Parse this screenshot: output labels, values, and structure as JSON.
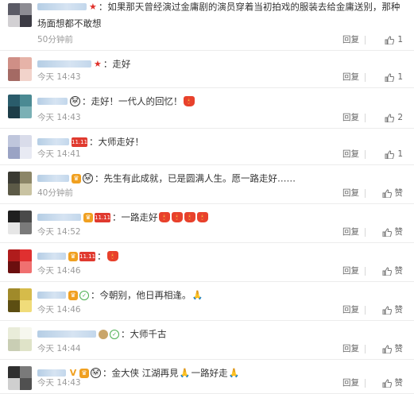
{
  "comments": [
    {
      "name_width": 62,
      "badges": [
        {
          "type": "star",
          "glyph": "★"
        }
      ],
      "text": "如果那天曾经演过金庸剧的演员穿着当初拍戏的服装去给金庸送别，那种场面想都不敢想",
      "emojis": [],
      "time": "50分钟前",
      "reply": "回复",
      "likes": "1",
      "avatar": [
        "#5b5b66",
        "#8d8c93",
        "#d2d0d3",
        "#3c3b44"
      ]
    },
    {
      "name_width": 68,
      "badges": [
        {
          "type": "star",
          "glyph": "★"
        }
      ],
      "text": "走好",
      "emojis": [],
      "time": "今天 14:43",
      "reply": "回复",
      "likes": "1",
      "avatar": [
        "#cf8f86",
        "#e6b3a8",
        "#a46a64",
        "#f2d3cb"
      ]
    },
    {
      "name_width": 38,
      "badges": [
        {
          "type": "panda",
          "glyph": "🐼"
        }
      ],
      "text": "走好！一代人的回忆！",
      "emojis": [
        {
          "type": "candle",
          "glyph": "🕯"
        }
      ],
      "time": "今天 14:43",
      "reply": "回复",
      "likes": "2",
      "avatar": [
        "#2a5c6b",
        "#4b8a93",
        "#1d3d48",
        "#7ab0b5"
      ]
    },
    {
      "name_width": 40,
      "badges": [
        {
          "type": "red",
          "glyph": "11.11"
        }
      ],
      "text": "大师走好！",
      "emojis": [],
      "time": "今天 14:41",
      "reply": "回复",
      "likes": "1",
      "avatar": [
        "#bfc6dc",
        "#d9dcea",
        "#9aa3c4",
        "#e8eaf3"
      ]
    },
    {
      "name_width": 40,
      "badges": [
        {
          "type": "gold",
          "glyph": "♛"
        },
        {
          "type": "panda",
          "glyph": "🐼"
        }
      ],
      "text": "先生有此成就，已是圆满人生。愿一路走好……",
      "emojis": [],
      "time": "40分钟前",
      "reply": "回复",
      "likes": "赞",
      "avatar": [
        "#3a3a32",
        "#8c8667",
        "#5c5a47",
        "#c9c3a2"
      ]
    },
    {
      "name_width": 55,
      "badges": [
        {
          "type": "gold",
          "glyph": "♛"
        },
        {
          "type": "red",
          "glyph": "11.11"
        }
      ],
      "text": "一路走好",
      "emojis": [
        {
          "type": "candle",
          "glyph": "🕯"
        },
        {
          "type": "candle",
          "glyph": "🕯"
        },
        {
          "type": "candle",
          "glyph": "🕯"
        },
        {
          "type": "candle",
          "glyph": "🕯"
        }
      ],
      "time": "今天 14:52",
      "reply": "回复",
      "likes": "赞",
      "avatar": [
        "#1f1f1f",
        "#4a4a4a",
        "#e6e6e6",
        "#7a7a7a"
      ]
    },
    {
      "name_width": 36,
      "badges": [
        {
          "type": "gold",
          "glyph": "♛"
        },
        {
          "type": "red",
          "glyph": "11.11"
        }
      ],
      "text": "",
      "emojis": [
        {
          "type": "candle",
          "glyph": "🕯"
        }
      ],
      "time": "今天 14:46",
      "reply": "回复",
      "likes": "赞",
      "avatar": [
        "#b01c1c",
        "#e03030",
        "#6b0f0f",
        "#f07070"
      ]
    },
    {
      "name_width": 36,
      "badges": [
        {
          "type": "gold",
          "glyph": "♛"
        },
        {
          "type": "green",
          "glyph": "✓"
        }
      ],
      "text": "今朝别，他日再相逢。",
      "emojis": [
        {
          "type": "pray",
          "glyph": "🙏"
        }
      ],
      "time": "今天 14:46",
      "reply": "回复",
      "likes": "赞",
      "avatar": [
        "#a08a2a",
        "#d6bb4a",
        "#5c4e12",
        "#f0dc7a"
      ]
    },
    {
      "name_width": 74,
      "badges": [
        {
          "type": "owl",
          "glyph": ""
        },
        {
          "type": "green",
          "glyph": "✓"
        }
      ],
      "text": "大师千古",
      "emojis": [],
      "time": "今天 14:44",
      "reply": "回复",
      "likes": "赞",
      "avatar": [
        "#e9ecd9",
        "#f6f7ee",
        "#c9ceb4",
        "#dfe3c8"
      ]
    },
    {
      "name_width": 36,
      "badges": [
        {
          "type": "vip",
          "glyph": "V"
        },
        {
          "type": "gold",
          "glyph": "♛"
        },
        {
          "type": "panda",
          "glyph": "🐼"
        }
      ],
      "text": "金大侠 江湖再見",
      "emojis": [
        {
          "type": "pray",
          "glyph": "🙏"
        }
      ],
      "text2": "一路好走",
      "emojis2": [
        {
          "type": "pray",
          "glyph": "🙏"
        }
      ],
      "time": "今天 14:43",
      "reply": "回复",
      "likes": "赞",
      "avatar": [
        "#2f2f2f",
        "#7a7a7a",
        "#cfcfcf",
        "#505050"
      ]
    }
  ]
}
